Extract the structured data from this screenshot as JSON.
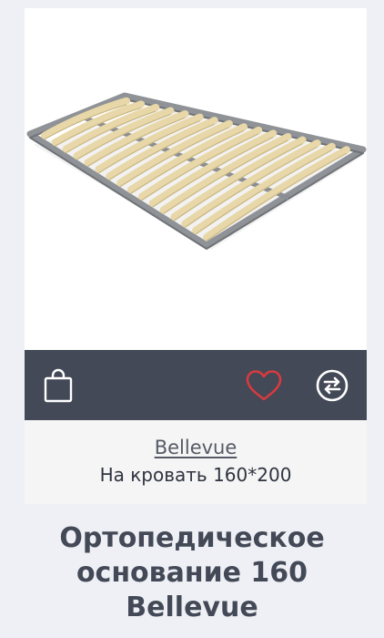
{
  "product": {
    "brand": "Bellevue",
    "size_label": "На кровать 160*200",
    "title_lines": [
      "Ортопедическое",
      "основание 160",
      "Bellevue"
    ]
  },
  "actions": {
    "bag_icon": "shopping-bag-icon",
    "favorite_icon": "heart-icon",
    "compare_icon": "compare-arrows-icon"
  },
  "colors": {
    "action_bar": "#434956",
    "heart": "#d83a3f",
    "title": "#434956"
  }
}
